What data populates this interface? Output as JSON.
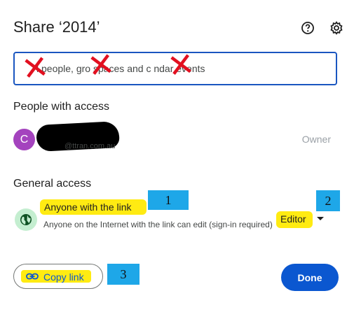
{
  "dialog": {
    "title": "Share ‘2014’",
    "search_placeholder": "Add people, groups, spaces and calendar events",
    "search_visible_text": "l people, gro spaces and c ndar events"
  },
  "people": {
    "heading": "People with access",
    "avatar_letter": "C",
    "email_partial": "@ttran.com.au",
    "role": "Owner"
  },
  "general": {
    "heading": "General access",
    "access_label": "Anyone with the link",
    "access_description": "Anyone on the Internet with the link can edit (sign-in required)",
    "role": "Editor"
  },
  "annotations": {
    "n1": "1",
    "n2": "2",
    "n3": "3"
  },
  "footer": {
    "copy_label": "Copy link",
    "done_label": "Done"
  },
  "colors": {
    "accent": "#0b57d0",
    "highlight": "#ffeb12",
    "callout": "#1ea7e8",
    "avatar": "#a443be",
    "strike": "#e21020"
  }
}
